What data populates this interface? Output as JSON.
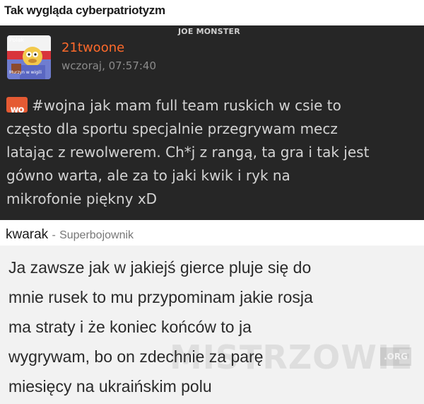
{
  "page": {
    "title": "Tak wygląda cyberpatriotyzm"
  },
  "post": {
    "watermark": "JOE MONSTER",
    "avatar": {
      "top_text": "Polak",
      "bottom_text": "Murzyn w wigili"
    },
    "username": "21twoone",
    "timestamp": "wczoraj, 07:57:40",
    "tag_icon": "wykop-tag-icon",
    "tag_icon_text": "wo",
    "hashtag": "#wojna",
    "lines": [
      " jak mam full team ruskich w csie to",
      "często dla sportu specjalnie przegrywam mecz",
      "latając z rewolwerem. Ch*j z rangą, ta gra i tak jest",
      "gówno warta, ale za to jaki kwik i ryk na",
      "mikrofonie piękny xD"
    ],
    "colors": {
      "background": "#262626",
      "username": "#ff6a2b",
      "text": "#d3d3d3",
      "tag_icon": "#e55a33"
    }
  },
  "comment": {
    "author": "kwarak",
    "separator": "-",
    "rank": "Superbojownik",
    "lines": [
      "Ja zawsze jak w jakiejś gierce pluje się do",
      "mnie rusek to mu przypominam jakie rosja",
      "ma straty i że koniec końców to ja",
      "wygrywam, bo on zdechnie za parę",
      "miesięcy na ukraińskim polu"
    ],
    "watermark": "MISTRZOWIE",
    "watermark_org": ".ORG"
  }
}
